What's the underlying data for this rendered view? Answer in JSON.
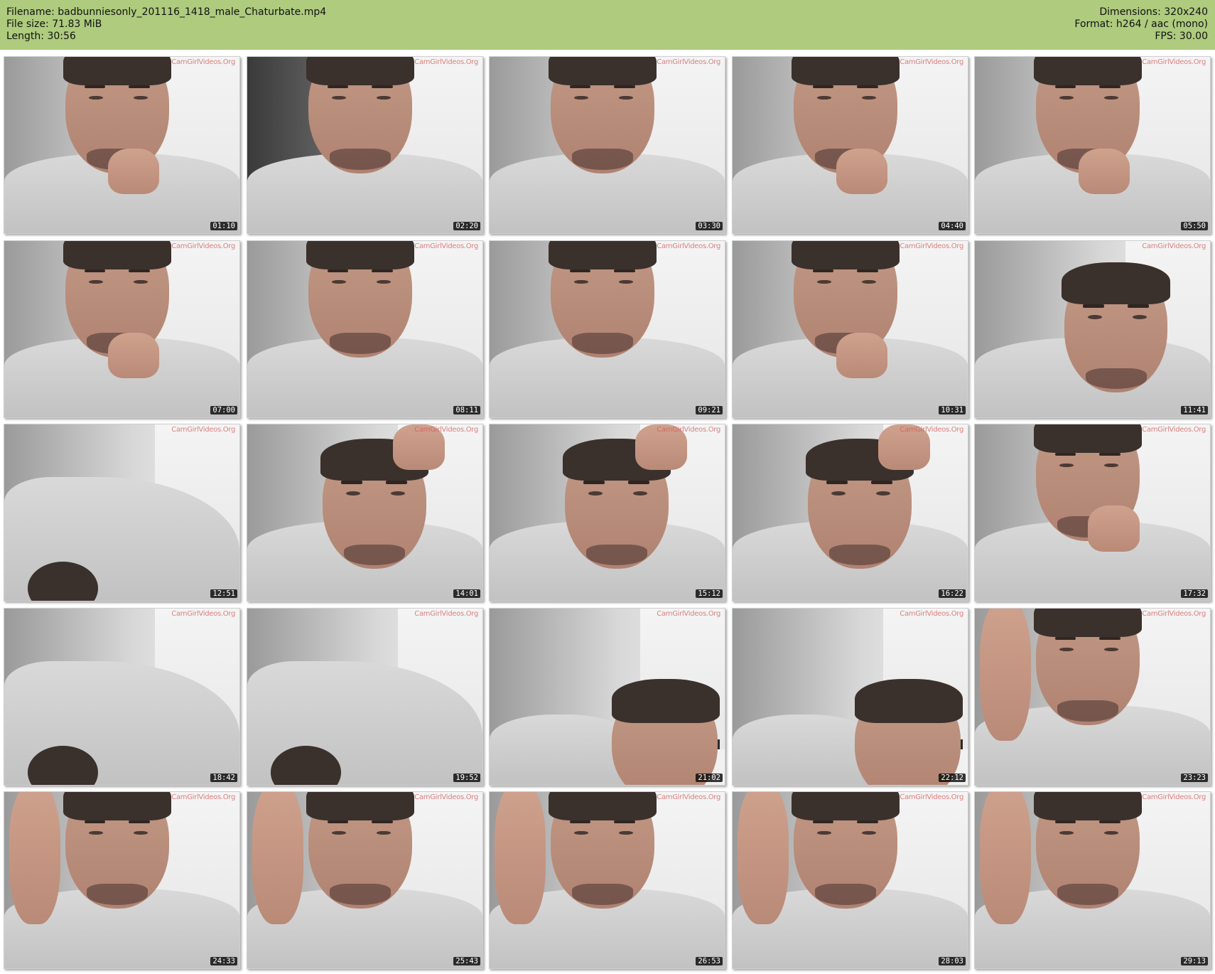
{
  "header": {
    "background": "#aecb7e",
    "filename_line": "Filename: badbunniesonly_201116_1418_male_Chaturbate.mp4",
    "filesize_line": "File size: 71.83 MiB",
    "length_line": "Length: 30:56",
    "dimensions_line": "Dimensions: 320x240",
    "format_line": "Format: h264 / aac (mono)",
    "fps_line": "FPS: 30.00"
  },
  "watermark_text": "CamGirlVideos.Org",
  "thumbnails": [
    {
      "timestamp": "01:10",
      "scene": "face-hand-chin"
    },
    {
      "timestamp": "02:20",
      "scene": "face-dark"
    },
    {
      "timestamp": "03:30",
      "scene": "face-looking-down"
    },
    {
      "timestamp": "04:40",
      "scene": "face-hand-mouth"
    },
    {
      "timestamp": "05:50",
      "scene": "face-hand-mouth"
    },
    {
      "timestamp": "07:00",
      "scene": "face-hand-mouth"
    },
    {
      "timestamp": "08:11",
      "scene": "face-looking-down"
    },
    {
      "timestamp": "09:21",
      "scene": "face-looking-down"
    },
    {
      "timestamp": "10:31",
      "scene": "face-hand-mouth"
    },
    {
      "timestamp": "11:41",
      "scene": "face-tilted"
    },
    {
      "timestamp": "12:51",
      "scene": "body-close"
    },
    {
      "timestamp": "14:01",
      "scene": "face-head-hand"
    },
    {
      "timestamp": "15:12",
      "scene": "face-head-hand"
    },
    {
      "timestamp": "16:22",
      "scene": "face-head-hand"
    },
    {
      "timestamp": "17:32",
      "scene": "face-hand-cheek"
    },
    {
      "timestamp": "18:42",
      "scene": "body-room"
    },
    {
      "timestamp": "19:52",
      "scene": "body-room"
    },
    {
      "timestamp": "21:02",
      "scene": "face-low-room"
    },
    {
      "timestamp": "22:12",
      "scene": "face-low-room"
    },
    {
      "timestamp": "23:23",
      "scene": "face-arm-raised"
    },
    {
      "timestamp": "24:33",
      "scene": "face-arm-raised"
    },
    {
      "timestamp": "25:43",
      "scene": "face-arm-raised"
    },
    {
      "timestamp": "26:53",
      "scene": "face-arm-raised"
    },
    {
      "timestamp": "28:03",
      "scene": "face-arm-raised"
    },
    {
      "timestamp": "29:13",
      "scene": "face-arm-raised"
    }
  ]
}
